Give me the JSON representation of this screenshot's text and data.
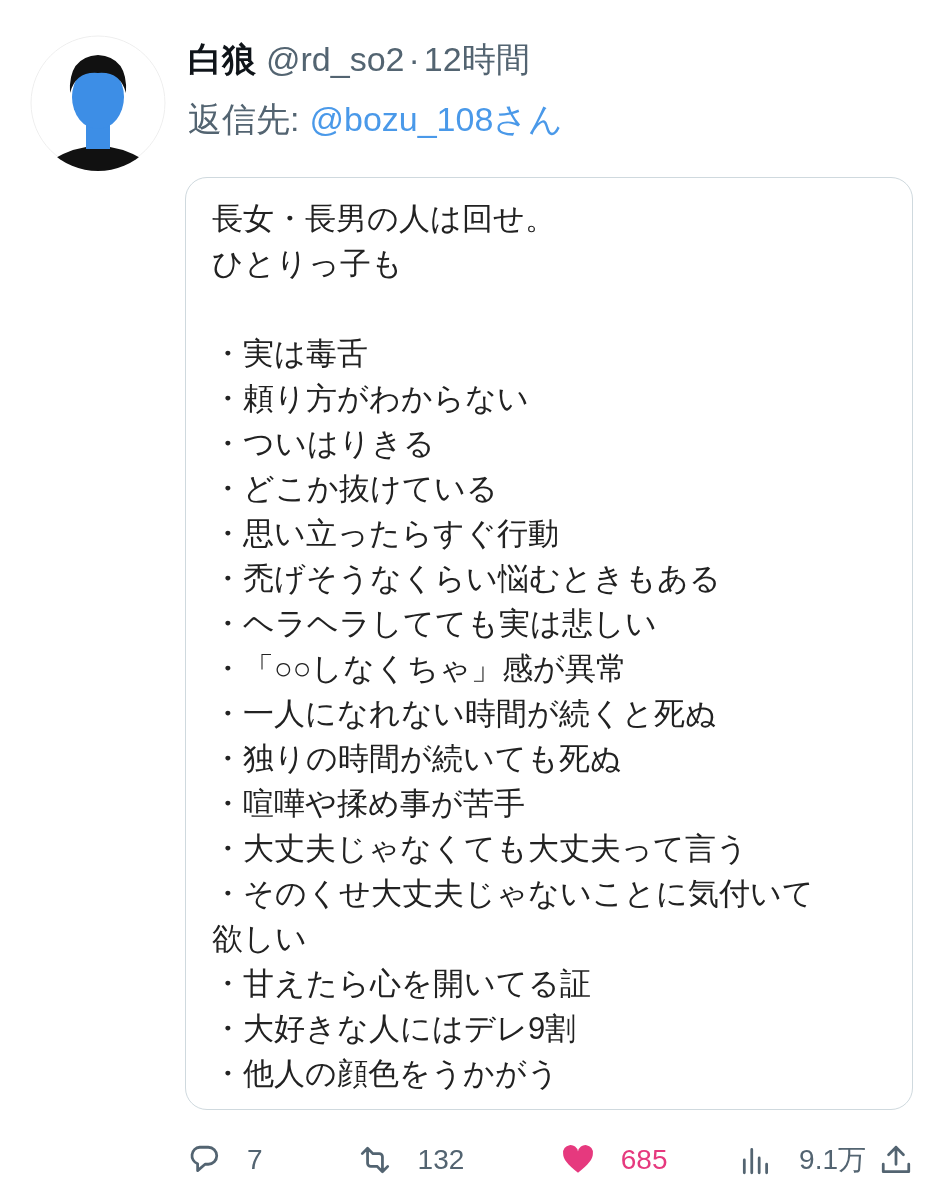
{
  "tweet": {
    "display_name": "白狼",
    "handle": "@rd_so2",
    "separator": "·",
    "time": "12時間",
    "reply_label": "返信先:",
    "reply_to": "@bozu_108さん"
  },
  "attachment": {
    "intro": [
      "長女・長男の人は回せ。",
      "ひとりっ子も"
    ],
    "lines": [
      "・実は毒舌",
      "・頼り方がわからない",
      "・ついはりきる",
      "・どこか抜けている",
      "・思い立ったらすぐ行動",
      "・禿げそうなくらい悩むときもある",
      "・ヘラヘラしてても実は悲しい",
      "・「○○しなくちゃ」感が異常",
      "・一人になれない時間が続くと死ぬ",
      "・独りの時間が続いても死ぬ",
      "・喧嘩や揉め事が苦手",
      "・大丈夫じゃなくても大丈夫って言う",
      "・そのくせ大丈夫じゃないことに気付いて",
      "欲しい",
      "・甘えたら心を開いてる証",
      "・大好きな人にはデレ9割",
      "・他人の顔色をうかがう"
    ]
  },
  "actions": [
    {
      "kind": "reply",
      "count": "7",
      "on": false
    },
    {
      "kind": "retweet",
      "count": "132",
      "on": false
    },
    {
      "kind": "like",
      "count": "685",
      "on": true
    },
    {
      "kind": "views",
      "count": "9.1万",
      "on": false
    },
    {
      "kind": "share",
      "on": false
    }
  ]
}
